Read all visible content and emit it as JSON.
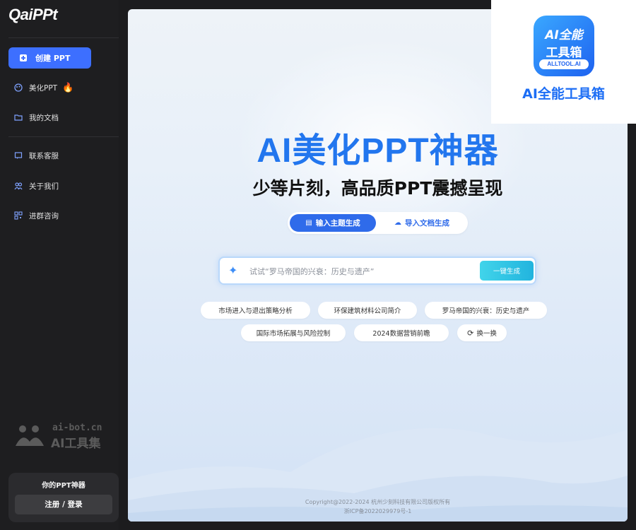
{
  "sidebar": {
    "logo": "QaiPPt",
    "create_button": "创建 PPT",
    "nav": [
      {
        "label": "美化PPT",
        "icon": "palette-icon",
        "badge": "🔥"
      },
      {
        "label": "我的文档",
        "icon": "folder-icon"
      },
      {
        "label": "联系客服",
        "icon": "headset-icon"
      },
      {
        "label": "关于我们",
        "icon": "team-icon"
      },
      {
        "label": "进群咨询",
        "icon": "qrcode-icon"
      }
    ],
    "promo": {
      "title": "你的PPT神器",
      "button": "注册 / 登录"
    }
  },
  "watermark": {
    "line1": "ai-bot.cn",
    "line2": "AI工具集"
  },
  "main": {
    "title": "AI美化PPT神器",
    "subtitle": "少等片刻，高品质PPT震撼呈现",
    "tabs": [
      {
        "label": "输入主题生成",
        "active": true
      },
      {
        "label": "导入文档生成",
        "active": false
      }
    ],
    "search": {
      "placeholder": "试试“罗马帝国的兴衰：历史与遗产”",
      "button": "一键生成"
    },
    "suggestions": [
      "市场进入与退出策略分析",
      "环保建筑材料公司简介",
      "罗马帝国的兴衰：历史与遗产",
      "国际市场拓展与风险控制",
      "2024数据营销前瞻"
    ],
    "refresh_label": "换一换",
    "footer": {
      "copyright": "Copyright@2022-2024 杭州少刻科技有限公司版权所有",
      "icp": "浙ICP备2022029979号-1"
    }
  },
  "ad": {
    "icon_line1": "AI全能",
    "icon_line2": "工具箱",
    "icon_line3": "ALLTOOL.AI",
    "name": "AI全能工具箱"
  },
  "colors": {
    "accent": "#3d6fff",
    "title_blue": "#2276ee",
    "sidebar_bg": "#1e1e20"
  }
}
